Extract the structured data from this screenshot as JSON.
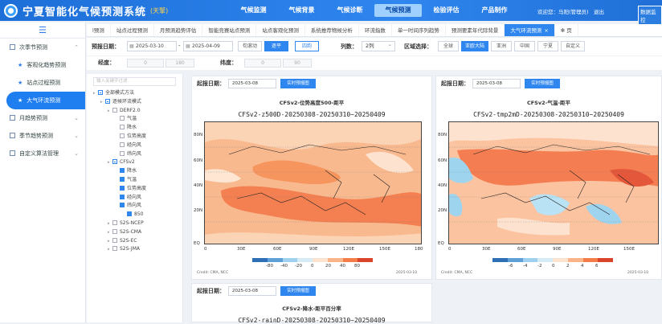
{
  "header": {
    "title": "宁夏智能化气候预测系统",
    "subtitle": "(天擎)",
    "nav": [
      "气候监测",
      "气候背景",
      "气候诊断",
      "气候预测",
      "检验评估",
      "产品制作"
    ],
    "active_nav": "气候预测",
    "user": "欢迎您：马阳(管理员)",
    "logout": "退出",
    "monitor": "数据监控"
  },
  "sidebar": {
    "toggle_icon": "menu-icon",
    "items": [
      {
        "label": "次季节预测",
        "arrow": "⌃"
      },
      {
        "label": "客观化趋势预测"
      },
      {
        "label": "站点过程预测"
      },
      {
        "label": "大气环流预测"
      },
      {
        "label": "月趋势预测",
        "arrow": "⌄"
      },
      {
        "label": "季节趋势预测",
        "arrow": "⌄"
      },
      {
        "label": "自定义算法管理",
        "arrow": "⌄"
      }
    ]
  },
  "tabs": [
    "l预测",
    "站点过程预测",
    "月预测趋势评估",
    "智能竞赛站点预测",
    "站点客观化预测",
    "系统推荐物候分析",
    "环流指数",
    "单一时间序列趋势",
    "预测要素年代际背景",
    "大气环流预测",
    "页"
  ],
  "active_tab": "大气环流预测",
  "toolbar": {
    "date_label": "预报日期：",
    "date_from": "2025-03-10",
    "date_sep": "-",
    "date_to": "2025-04-09",
    "btn1": "旬滚动",
    "btn2": "逐平",
    "btn3": "四韵",
    "cols_label": "列数：",
    "cols_value": "2列",
    "region_label": "区域选择：",
    "regions": [
      "全球",
      "亚欧大陆",
      "亚洲",
      "中国",
      "宁夏",
      "自定义"
    ],
    "active_region": "亚欧大陆"
  },
  "row2": {
    "lon_label": "经度：",
    "lon_from": "0",
    "lon_to": "180",
    "lat_label": "纬度：",
    "lat_from": "0",
    "lat_to": "90"
  },
  "tree": {
    "search_placeholder": "输入关键字过滤",
    "nodes": [
      {
        "label": "全部模式方法",
        "level": 0,
        "cb": "half"
      },
      {
        "label": "逐候环流模式",
        "level": 1,
        "cb": "half"
      },
      {
        "label": "DERF2.0",
        "level": 2,
        "cb": "off"
      },
      {
        "label": "气温",
        "level": 3,
        "cb": "off"
      },
      {
        "label": "降水",
        "level": 3,
        "cb": "off"
      },
      {
        "label": "位势高度",
        "level": 3,
        "cb": "off"
      },
      {
        "label": "经向风",
        "level": 3,
        "cb": "off"
      },
      {
        "label": "纬向风",
        "level": 3,
        "cb": "off"
      },
      {
        "label": "CFSv2",
        "level": 2,
        "cb": "half"
      },
      {
        "label": "降水",
        "level": 3,
        "cb": "on"
      },
      {
        "label": "气温",
        "level": 3,
        "cb": "on"
      },
      {
        "label": "位势高度",
        "level": 3,
        "cb": "on"
      },
      {
        "label": "经向风",
        "level": 3,
        "cb": "on"
      },
      {
        "label": "纬向风",
        "level": 3,
        "cb": "on"
      },
      {
        "label": "850",
        "level": 4,
        "cb": "on"
      },
      {
        "label": "S2S-NCEP",
        "level": 2,
        "cb": "off"
      },
      {
        "label": "S2S-CMA",
        "level": 2,
        "cb": "off"
      },
      {
        "label": "S2S-EC",
        "level": 2,
        "cb": "off"
      },
      {
        "label": "S2S-JMA",
        "level": 2,
        "cb": "off"
      }
    ]
  },
  "panels": [
    {
      "label": "起报日期：",
      "date": "2025-03-08",
      "btn": "实时预报图",
      "title": "CFSv2-位势高度500-距平",
      "map_title": "CFSv2-z500D-20250308-20250310~20250409",
      "credit": "Credit: CMA, NCC",
      "date_note": "2025-03-10"
    },
    {
      "label": "起报日期：",
      "date": "2025-03-08",
      "btn": "实时预报图",
      "title": "CFSv2-气温-距平",
      "map_title": "CFSv2-tmp2mD-20250308-20250310~20250409",
      "credit": "Credit: CMA, NCC",
      "date_note": "2025-03-10"
    },
    {
      "label": "起报日期：",
      "date": "2025-03-08",
      "btn": "实时预报图",
      "title": "CFSv2-降水-距平百分率",
      "map_title": "CFSv2-rainD-20250308-20250310~20250409"
    }
  ],
  "axes": {
    "lat": [
      "80N",
      "60N",
      "40N",
      "20N",
      "EQ"
    ],
    "lon_left": [
      "0",
      "30E",
      "60E",
      "90E",
      "120E",
      "150E",
      "180"
    ],
    "lon_right": [
      "0",
      "30E",
      "60E",
      "90E",
      "120E",
      "150E"
    ]
  },
  "colorbar_left": [
    "-80",
    "-40",
    "-20",
    "0",
    "20",
    "40",
    "80"
  ],
  "colorbar_right": [
    "-6",
    "-4",
    "-2",
    "0",
    "2",
    "4",
    "6"
  ],
  "colors": {
    "primary": "#2f86ee",
    "header": "#1d6fd8",
    "warm": "#f26d3d",
    "cool": "#9fd4ef"
  }
}
